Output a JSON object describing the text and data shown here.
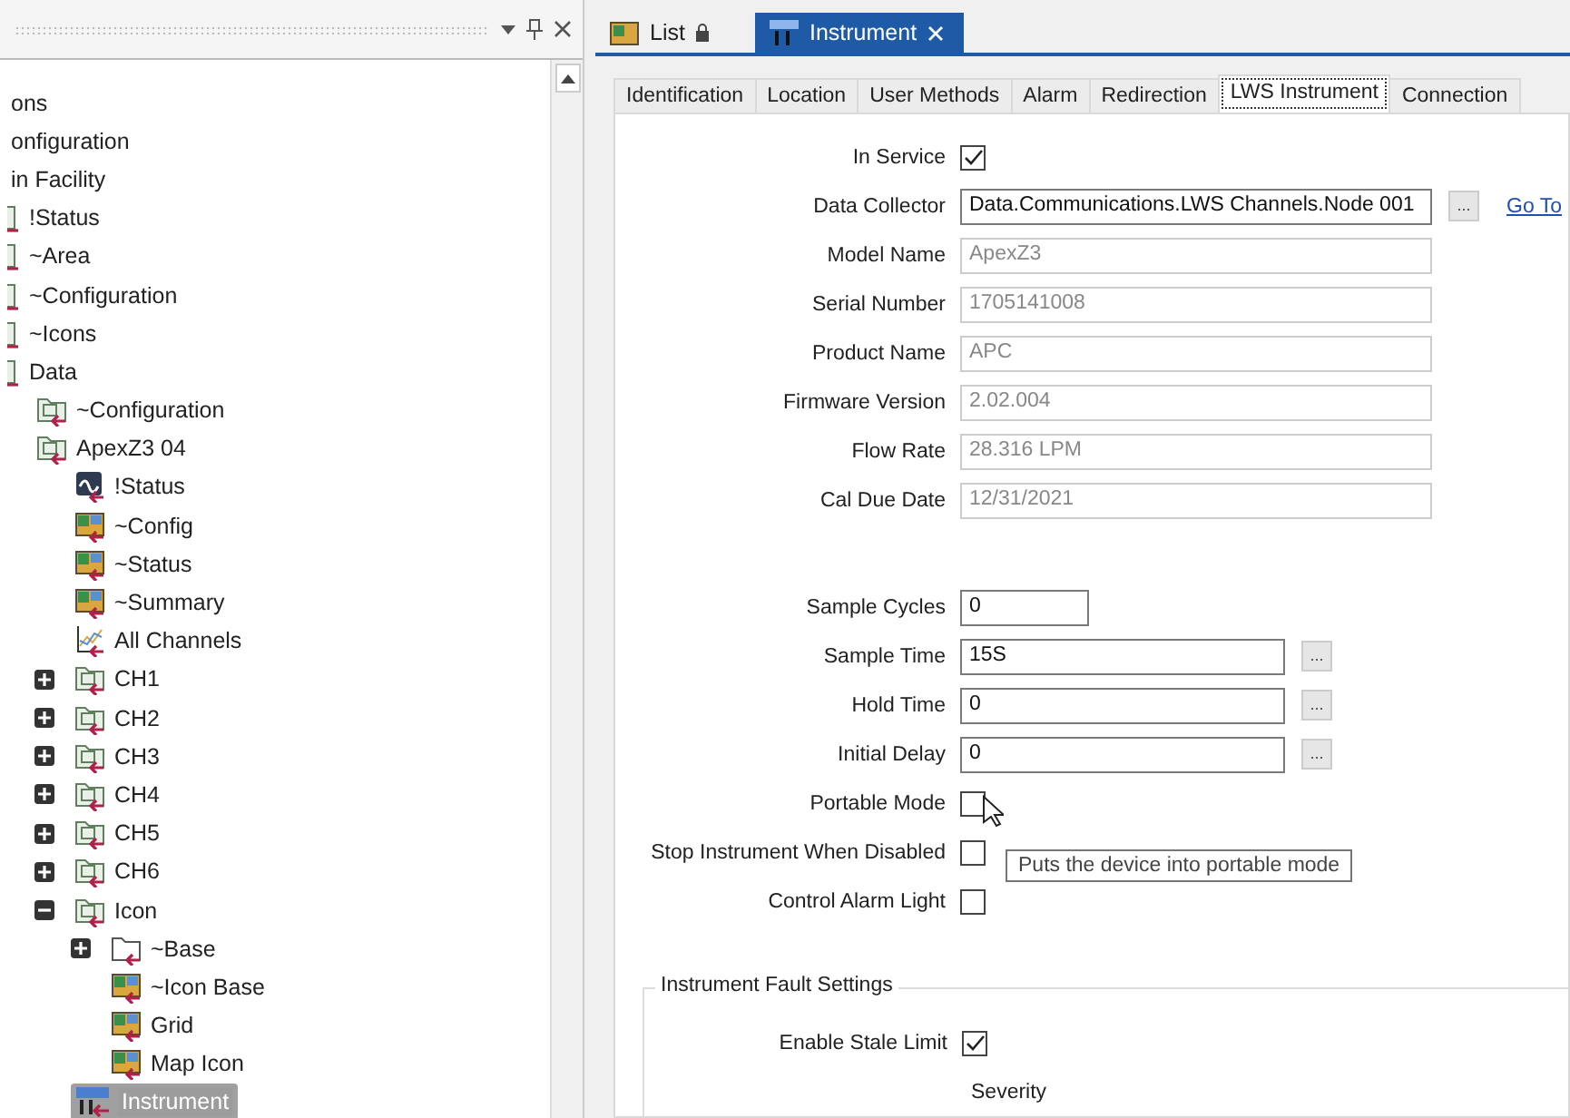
{
  "tree_pane": {
    "tree": [
      {
        "label": "ons"
      },
      {
        "label": "onfiguration"
      },
      {
        "label": "in Facility",
        "children": [
          {
            "label": "!Status",
            "kind": "cut"
          },
          {
            "label": "~Area",
            "kind": "cut"
          },
          {
            "label": "~Configuration",
            "kind": "cut"
          },
          {
            "label": "~Icons",
            "kind": "cut"
          },
          {
            "label": "Data",
            "kind": "cut",
            "children": [
              {
                "label": "~Configuration",
                "kind": "folder"
              },
              {
                "label": "ApexZ3 04",
                "kind": "folder",
                "children": [
                  {
                    "label": "!Status",
                    "kind": "status"
                  },
                  {
                    "label": "~Config",
                    "kind": "display"
                  },
                  {
                    "label": "~Status",
                    "kind": "display"
                  },
                  {
                    "label": "~Summary",
                    "kind": "display"
                  },
                  {
                    "label": "All Channels",
                    "kind": "chart"
                  },
                  {
                    "label": "CH1",
                    "kind": "folder",
                    "expanded": false
                  },
                  {
                    "label": "CH2",
                    "kind": "folder",
                    "expanded": false
                  },
                  {
                    "label": "CH3",
                    "kind": "folder",
                    "expanded": false
                  },
                  {
                    "label": "CH4",
                    "kind": "folder",
                    "expanded": false
                  },
                  {
                    "label": "CH5",
                    "kind": "folder",
                    "expanded": false
                  },
                  {
                    "label": "CH6",
                    "kind": "folder",
                    "expanded": false
                  },
                  {
                    "label": "Icon",
                    "kind": "folder",
                    "expanded": true,
                    "children": [
                      {
                        "label": "~Base",
                        "kind": "empty-folder",
                        "expanded": false
                      },
                      {
                        "label": "~Icon Base",
                        "kind": "display"
                      },
                      {
                        "label": "Grid",
                        "kind": "display"
                      },
                      {
                        "label": "Map Icon",
                        "kind": "display"
                      }
                    ]
                  },
                  {
                    "label": "Instrument",
                    "kind": "instrument",
                    "selected": true
                  }
                ]
              }
            ]
          }
        ]
      }
    ]
  },
  "doc_tabs": [
    {
      "label": "List",
      "kind": "list",
      "selected": false
    },
    {
      "label": "Instrument",
      "kind": "instrument",
      "selected": true
    }
  ],
  "prop_tabs": [
    {
      "label": "Identification",
      "selected": false
    },
    {
      "label": "Location",
      "selected": false
    },
    {
      "label": "User Methods",
      "selected": false
    },
    {
      "label": "Alarm",
      "selected": false
    },
    {
      "label": "Redirection",
      "selected": false
    },
    {
      "label": "LWS Instrument",
      "selected": true
    },
    {
      "label": "Connection",
      "selected": false
    }
  ],
  "form": [
    {
      "kind": "checkbox",
      "label": "In Service",
      "checked": true
    },
    {
      "kind": "wide",
      "label": "Data Collector",
      "value": "Data.Communications.LWS Channels.Node 001",
      "disabled": false,
      "browse": "...",
      "link": "Go To"
    },
    {
      "kind": "wide",
      "label": "Model Name",
      "value": "ApexZ3",
      "disabled": true
    },
    {
      "kind": "wide",
      "label": "Serial Number",
      "value": "1705141008",
      "disabled": true
    },
    {
      "kind": "wide",
      "label": "Product Name",
      "value": "APC",
      "disabled": true
    },
    {
      "kind": "wide",
      "label": "Firmware Version",
      "value": "2.02.004",
      "disabled": true
    },
    {
      "kind": "wide",
      "label": "Flow Rate",
      "value": "28.316 LPM",
      "disabled": true
    },
    {
      "kind": "wide",
      "label": "Cal Due Date",
      "value": "12/31/2021",
      "disabled": true
    }
  ],
  "form2": [
    {
      "kind": "short",
      "label": "Sample Cycles",
      "value": "0",
      "disabled": false
    },
    {
      "kind": "medium",
      "label": "Sample Time",
      "value": "15S",
      "disabled": false,
      "browse": "..."
    },
    {
      "kind": "medium",
      "label": "Hold Time",
      "value": "0",
      "disabled": false,
      "browse": "..."
    },
    {
      "kind": "medium",
      "label": "Initial Delay",
      "value": "0",
      "disabled": false,
      "browse": "..."
    },
    {
      "kind": "checkbox",
      "label": "Portable Mode",
      "checked": false
    },
    {
      "kind": "checkbox",
      "label": "Stop Instrument When Disabled",
      "checked": false
    },
    {
      "kind": "checkbox",
      "label": "Control Alarm Light",
      "checked": false
    }
  ],
  "tooltip": "Puts the device into portable mode",
  "fault_group": {
    "title": "Instrument Fault Settings",
    "rows": [
      {
        "kind": "checkbox",
        "label": "Enable Stale Limit",
        "checked": true
      }
    ],
    "column_header": "Severity"
  }
}
